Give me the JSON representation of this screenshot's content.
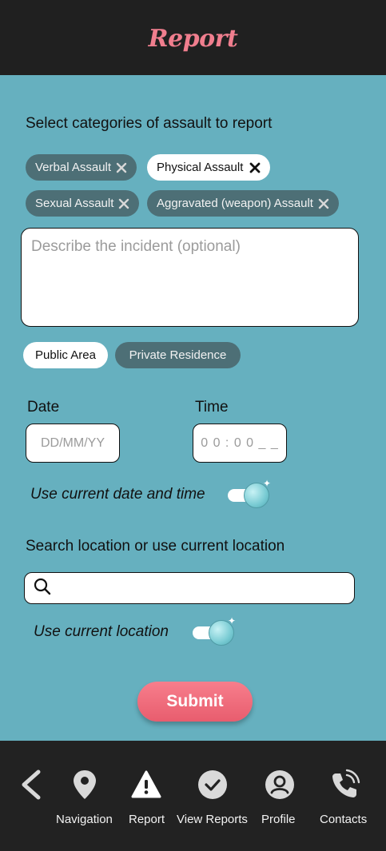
{
  "header": {
    "title": "Report"
  },
  "categories": {
    "title": "Select categories of assault to report",
    "chips": [
      {
        "label": "Verbal Assault",
        "selected": false
      },
      {
        "label": "Physical Assault",
        "selected": true
      },
      {
        "label": "Sexual Assault",
        "selected": false
      },
      {
        "label": "Aggravated (weapon) Assault",
        "selected": false
      }
    ]
  },
  "description": {
    "placeholder": "Describe the incident (optional)"
  },
  "location_type": [
    {
      "label": "Public Area",
      "selected": true
    },
    {
      "label": "Private Residence",
      "selected": false
    }
  ],
  "datetime": {
    "date_label": "Date",
    "date_placeholder": "DD/MM/YY",
    "time_label": "Time",
    "time_placeholder": "0 0 : 0 0 _ _",
    "toggle_label": "Use current date and time",
    "toggle_on": true
  },
  "location": {
    "title": "Search location or use current location",
    "search_value": "",
    "toggle_label": "Use current location",
    "toggle_on": true
  },
  "submit_label": "Submit",
  "nav": {
    "back_icon": "back-chevron-icon",
    "items": [
      {
        "label": "Navigation",
        "icon": "map-pin-icon"
      },
      {
        "label": "Report",
        "icon": "warning-icon",
        "active": true
      },
      {
        "label": "View Reports",
        "icon": "check-circle-icon"
      },
      {
        "label": "Profile",
        "icon": "user-icon"
      },
      {
        "label": "Contacts",
        "icon": "phone-icon"
      }
    ]
  },
  "colors": {
    "background": "#66b0bf",
    "header": "#202020",
    "accent": "#f07e8e",
    "chip_dark": "#4d6f76"
  }
}
